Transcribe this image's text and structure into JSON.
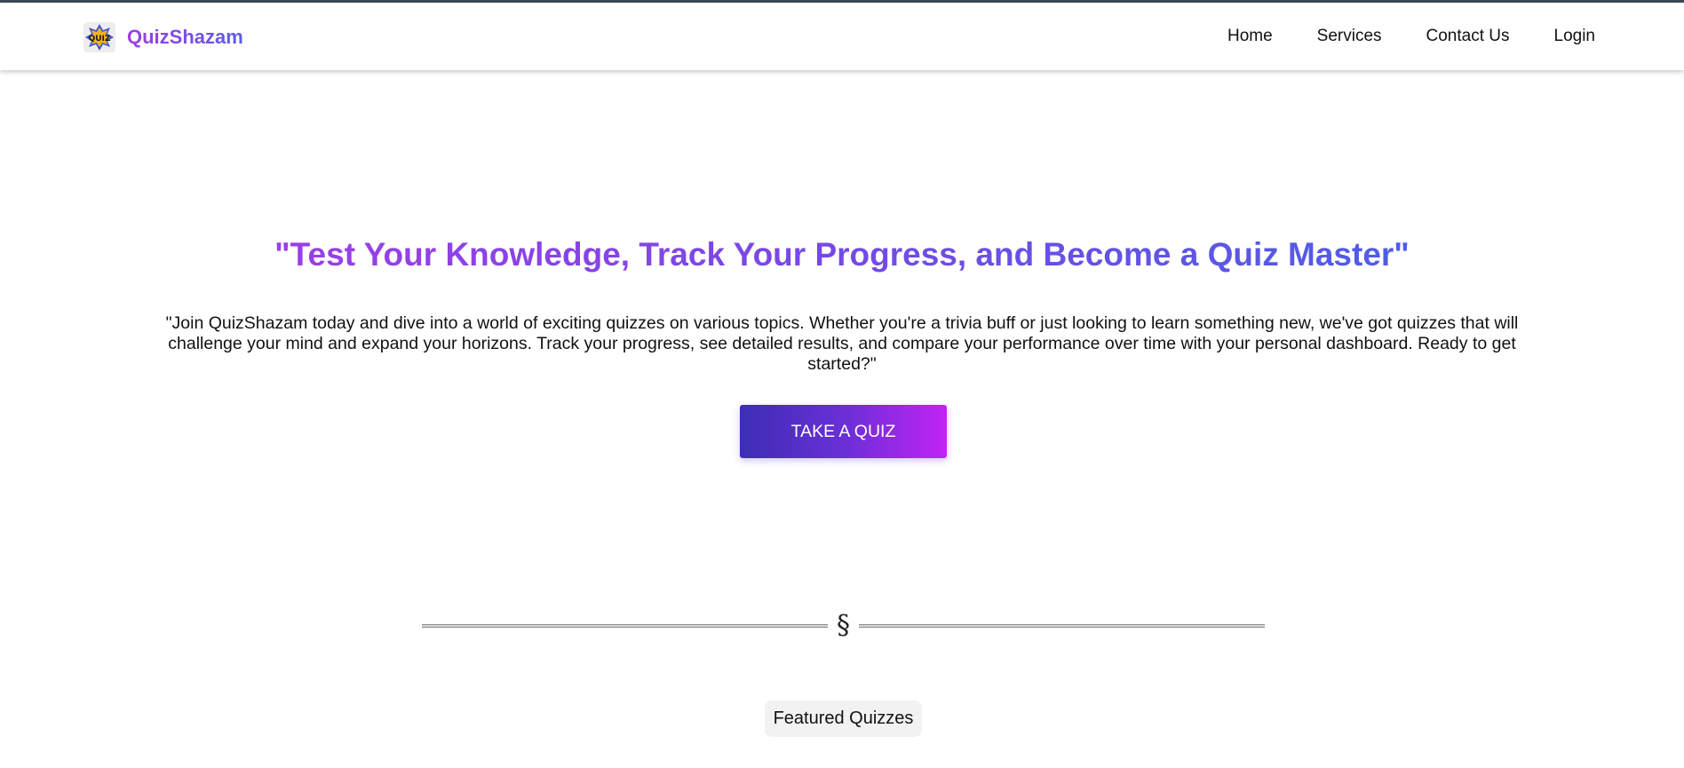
{
  "navbar": {
    "brand_name": "QuizShazam",
    "logo_icon": "quiz-logo-icon",
    "links": [
      {
        "label": "Home"
      },
      {
        "label": "Services"
      },
      {
        "label": "Contact Us"
      },
      {
        "label": "Login"
      }
    ]
  },
  "hero": {
    "title": "\"Test Your Knowledge, Track Your Progress, and Become a Quiz Master\"",
    "description": "\"Join QuizShazam today and dive into a world of exciting quizzes on various topics. Whether you're a trivia buff or just looking to learn something new, we've got quizzes that will challenge your mind and expand your horizons. Track your progress, see detailed results, and compare your performance over time with your personal dashboard. Ready to get started?\"",
    "cta_label": "TAKE A QUIZ"
  },
  "divider": {
    "symbol": "§"
  },
  "featured": {
    "label": "Featured Quizzes"
  },
  "colors": {
    "accent_purple": "#9b3ee6",
    "accent_blue": "#4f5de6",
    "button_start": "#3c2eb4",
    "button_end": "#c123f5"
  }
}
